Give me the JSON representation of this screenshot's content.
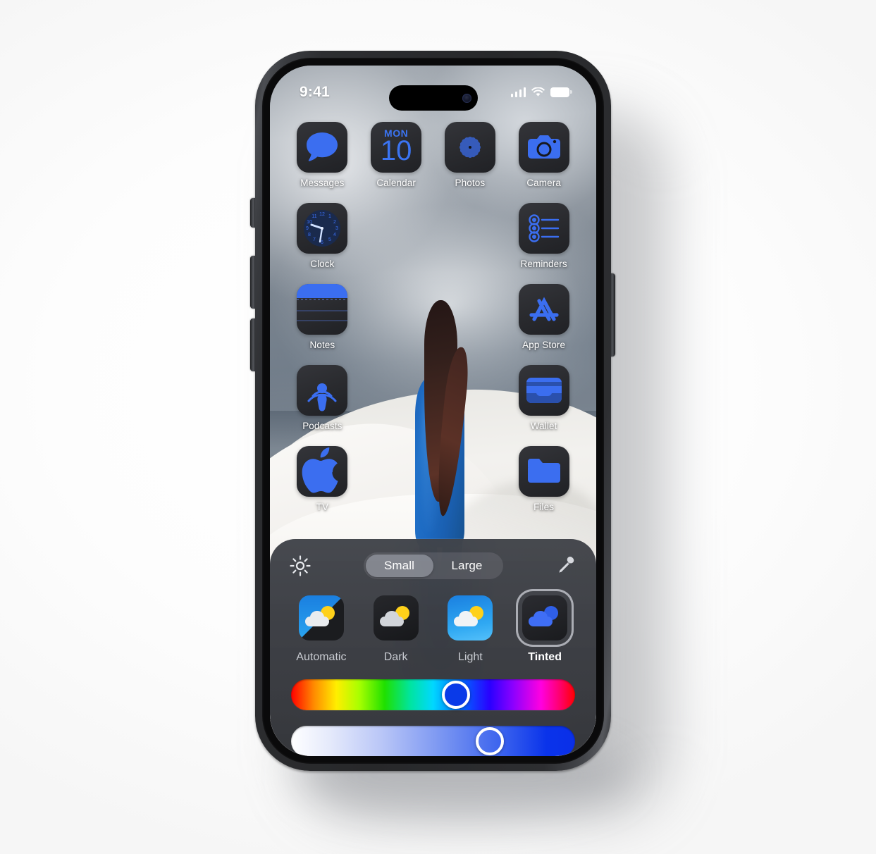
{
  "device": {
    "name": "iphone-15-pro",
    "frame_color": "#2d2e31",
    "buttons": [
      "action-button",
      "volume-up-button",
      "volume-down-button",
      "side-power-button"
    ]
  },
  "status_bar": {
    "time": "9:41",
    "cellular_icon": "cellular-bars-icon",
    "cellular_bars": 4,
    "wifi_icon": "wifi-icon",
    "battery_icon": "battery-icon",
    "battery_full": true
  },
  "wallpaper": {
    "description": "Woman in blue suit walking away across white sand dunes under a cloudy grey sky"
  },
  "home_screen": {
    "rows": [
      [
        {
          "label": "Messages",
          "icon": "messages-icon",
          "empty": false
        },
        {
          "label": "Calendar",
          "icon": "calendar-icon",
          "empty": false,
          "day_of_week": "MON",
          "day": "10"
        },
        {
          "label": "Photos",
          "icon": "photos-icon",
          "empty": false
        },
        {
          "label": "Camera",
          "icon": "camera-icon",
          "empty": false
        }
      ],
      [
        {
          "label": "Clock",
          "icon": "clock-icon",
          "empty": false
        },
        {
          "label": "",
          "icon": "",
          "empty": true
        },
        {
          "label": "",
          "icon": "",
          "empty": true
        },
        {
          "label": "Reminders",
          "icon": "reminders-icon",
          "empty": false
        }
      ],
      [
        {
          "label": "Notes",
          "icon": "notes-icon",
          "empty": false
        },
        {
          "label": "",
          "icon": "",
          "empty": true
        },
        {
          "label": "",
          "icon": "",
          "empty": true
        },
        {
          "label": "App Store",
          "icon": "app-store-icon",
          "empty": false
        }
      ],
      [
        {
          "label": "Podcasts",
          "icon": "podcasts-icon",
          "empty": false
        },
        {
          "label": "",
          "icon": "",
          "empty": true
        },
        {
          "label": "",
          "icon": "",
          "empty": true
        },
        {
          "label": "Wallet",
          "icon": "wallet-icon",
          "empty": false
        }
      ],
      [
        {
          "label": "TV",
          "icon": "tv-icon",
          "empty": false
        },
        {
          "label": "",
          "icon": "",
          "empty": true
        },
        {
          "label": "",
          "icon": "",
          "empty": true
        },
        {
          "label": "Files",
          "icon": "files-icon",
          "empty": false
        }
      ]
    ]
  },
  "customize_panel": {
    "brightness_icon": "brightness-sun-icon",
    "eyedropper_icon": "eyedropper-icon",
    "size_segments": [
      {
        "label": "Small",
        "selected": true
      },
      {
        "label": "Large",
        "selected": false
      }
    ],
    "appearance_options": [
      {
        "label": "Automatic",
        "selected": false,
        "preview_icon": "weather-app-automatic-icon"
      },
      {
        "label": "Dark",
        "selected": false,
        "preview_icon": "weather-app-dark-icon"
      },
      {
        "label": "Light",
        "selected": false,
        "preview_icon": "weather-app-light-icon"
      },
      {
        "label": "Tinted",
        "selected": true,
        "preview_icon": "weather-app-tinted-icon"
      }
    ],
    "hue_slider": {
      "name": "hue-slider",
      "position_percent": 58,
      "knob_color": "#0a3ae8"
    },
    "saturation_slider": {
      "name": "saturation-slider",
      "position_percent": 70
    }
  },
  "colors": {
    "tint_blue": "#2f6fe0",
    "panel_bg": "#3f4248",
    "icon_dark": "#2a2b2f"
  }
}
